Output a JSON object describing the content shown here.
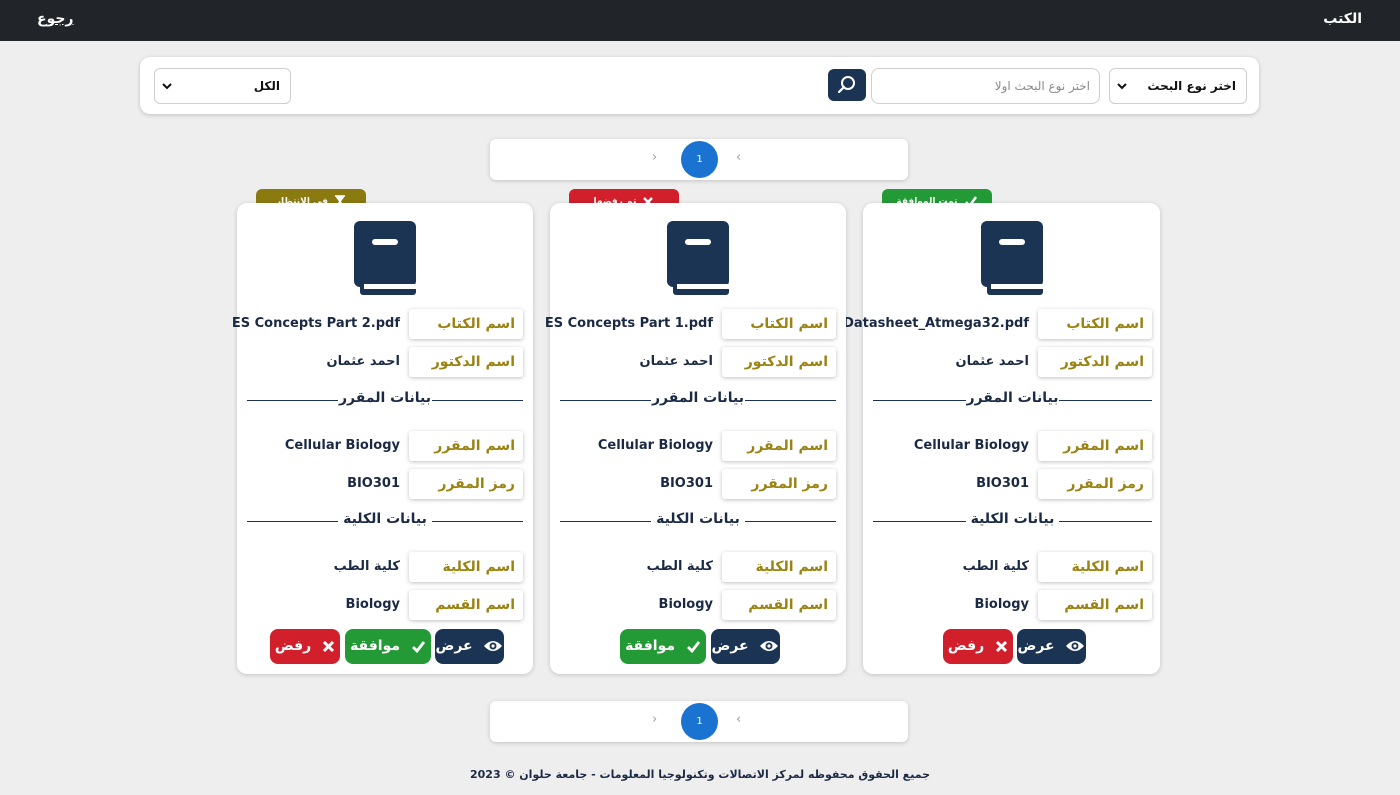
{
  "header": {
    "title": "الكتب",
    "back": "رجوع"
  },
  "search": {
    "type_select": "اختر نوع البحث",
    "placeholder": "اختر نوع البحث اولا",
    "filter_select": "الكل"
  },
  "pagination": {
    "current": "1"
  },
  "labels": {
    "book_name": "اسم الكتاب",
    "doctor_name": "اسم الدكتور",
    "course_section": "بيانات المقرر",
    "course_name": "اسم المقرر",
    "course_code": "رمز المقرر",
    "college_section": "بيانات الكلية",
    "college_name": "اسم الكلية",
    "department": "اسم القسم"
  },
  "buttons": {
    "view": "عرض",
    "approve": "موافقة",
    "reject": "رفض"
  },
  "status_colors": {
    "approved": "#239a36",
    "rejected": "#d11f2b",
    "pending": "#8a7a10"
  },
  "cards": [
    {
      "status": "تمت الموافقة",
      "status_icon": "check-icon",
      "book": "Datasheet_Atmega32.pdf",
      "doctor": "احمد عثمان",
      "course": "Cellular Biology",
      "code": "BIO301",
      "college": "كلية الطب",
      "department": "Biology"
    },
    {
      "status": "تم رفضها",
      "status_icon": "x-icon",
      "book": "ES Concepts Part 1.pdf",
      "doctor": "احمد عثمان",
      "course": "Cellular Biology",
      "code": "BIO301",
      "college": "كلية الطب",
      "department": "Biology"
    },
    {
      "status": "في الانتظار",
      "status_icon": "hourglass-icon",
      "book": "ES Concepts Part 2.pdf",
      "doctor": "احمد عثمان",
      "course": "Cellular Biology",
      "code": "BIO301",
      "college": "كلية الطب",
      "department": "Biology"
    }
  ],
  "footer": "جميع الحقوق محفوظه لمركز الاتصالات وتكنولوجيا المعلومات - جامعة حلوان © 2023"
}
